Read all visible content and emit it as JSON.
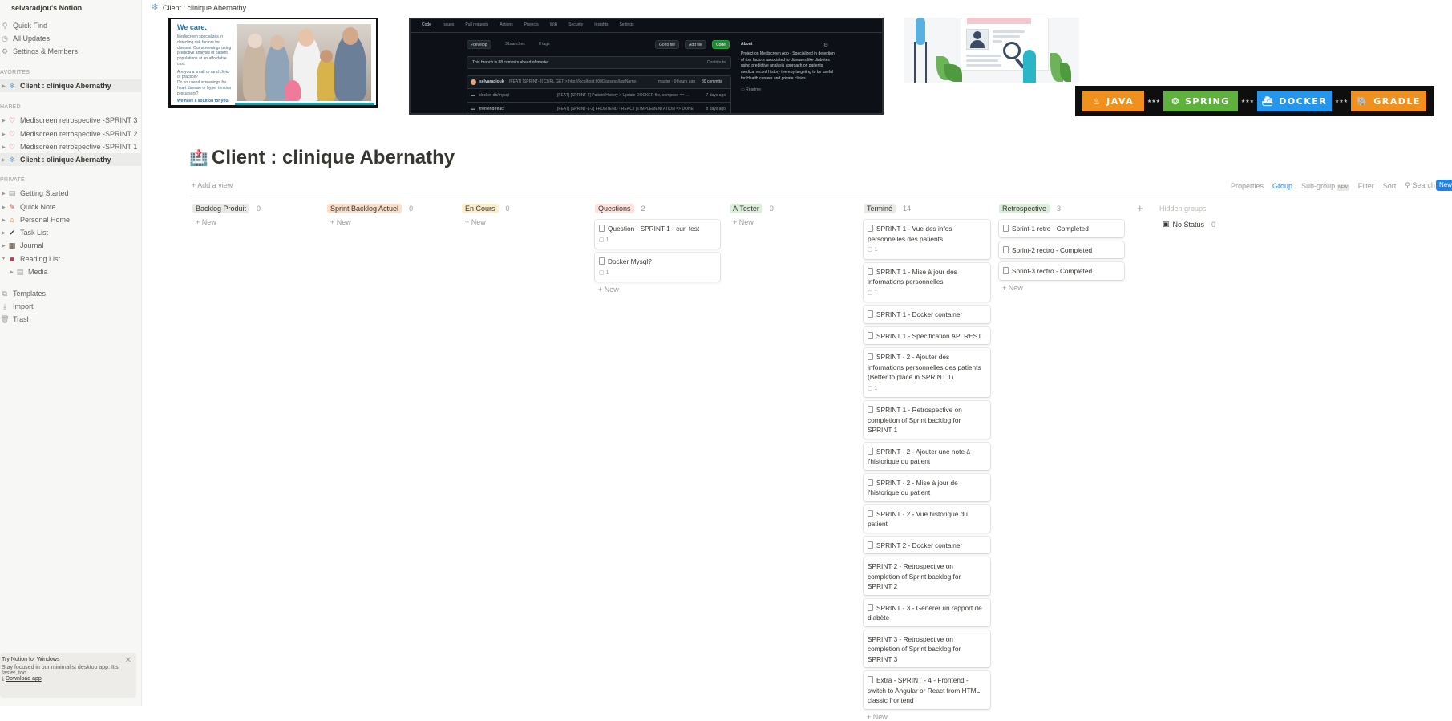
{
  "sidebar": {
    "workspace": "selvaradjou's Notion",
    "top_items": [
      {
        "icon": "search-icon",
        "glyph": "⚲",
        "label": "Quick Find"
      },
      {
        "icon": "clock-icon",
        "glyph": "◷",
        "label": "All Updates"
      },
      {
        "icon": "gear-icon",
        "glyph": "⚙",
        "label": "Settings & Members"
      }
    ],
    "favorites_header": "AVORITES",
    "favorites": [
      {
        "label": "Client : clinique Abernathy"
      }
    ],
    "shared_header": "HARED",
    "shared": [
      {
        "label": "Mediscreen retrospective -SPRINT 3"
      },
      {
        "label": "Mediscreen retrospective -SPRINT 2"
      },
      {
        "label": "Mediscreen retrospective -SPRINT 1"
      },
      {
        "label": "Client : clinique Abernathy"
      }
    ],
    "private_header": "PRIVATE",
    "private": [
      {
        "label": "Getting Started"
      },
      {
        "label": "Quick Note"
      },
      {
        "label": "Personal Home"
      },
      {
        "label": "Task List"
      },
      {
        "label": "Journal"
      },
      {
        "label": "Reading List"
      },
      {
        "label": "Media"
      }
    ],
    "bottom": [
      {
        "label": "Templates"
      },
      {
        "label": "Import"
      },
      {
        "label": "Trash"
      }
    ],
    "promo": {
      "title": "Try Notion for Windows",
      "line1": "Stay focused in our minimalist desktop app. It's",
      "line2": "faster, too.",
      "link": "Download app"
    }
  },
  "topbar": {
    "breadcrumb": "Client : clinique Abernathy"
  },
  "covers": {
    "care": {
      "heading": "We care.",
      "p1": "Mediscreen specializes in detecting risk factors for disease. Our screenings using predictive analysis of patient populations at an affordable cost.",
      "b1": "Are you a small or rural clinic or practice?",
      "b2": "Do you need screenings for heart disease or hyper tension precursors?",
      "solution": "We have a solution for you."
    },
    "github": {
      "tabs": [
        "Code",
        "Issues",
        "Pull requests",
        "Actions",
        "Projects",
        "Wiki",
        "Security",
        "Insights",
        "Settings"
      ],
      "branch": "develop",
      "branches": "3 branches",
      "tags": "0 tags",
      "goto": "Go to file",
      "addfile": "Add file",
      "code": "Code",
      "ahead": "This branch is 88 commits ahead of master.",
      "contribute": "Contribute",
      "commit_user": "selvaradjouk",
      "commit_msg": "[FEAT] [SPRINT-3] CURL GET > http://localhost:8080/assess/lastName...",
      "commit_meta": "master · 9 hours ago",
      "commits": "80 commits",
      "files": [
        {
          "name": "docker-db/mysql",
          "msg": "[FEAT] [SPRINT-2] Patient History > Update DOCKER file, compose == ...",
          "age": "7 days ago"
        },
        {
          "name": "frontend-react",
          "msg": "[FEAT] [SPRINT-1-2] FRONTEND - REACT js IMPLEMENTATION => DONE",
          "age": "8 days ago"
        }
      ],
      "about_title": "About",
      "about": "Project on Mediscreen App - Specialized in detection of risk factors associated to diseases like diabetes using predictive analysis approach on patients medical record history thereby targeting to be useful for Health centers and private clinics.",
      "readme": "Readme"
    },
    "tech": [
      {
        "name": "JAVA",
        "icon": "java-icon",
        "glyph": "♨",
        "color": "#f0901e"
      },
      {
        "name": "SPRING",
        "icon": "spring-icon",
        "glyph": "❂",
        "color": "#5fb13e"
      },
      {
        "name": "DOCKER",
        "icon": "docker-icon",
        "glyph": "⛴",
        "color": "#2496ed"
      },
      {
        "name": "GRADLE",
        "icon": "gradle-icon",
        "glyph": "🐘",
        "color": "#f0901e"
      }
    ],
    "tech_separator": "★★★"
  },
  "page": {
    "title": "Client : clinique Abernathy",
    "icon": "hospital-icon"
  },
  "view": {
    "add_view": "Add a view",
    "tools": {
      "properties": "Properties",
      "group": "Group",
      "subgroup": "Sub-group",
      "new_badge": "NEW",
      "filter": "Filter",
      "sort": "Sort",
      "search": "Search",
      "more": "···",
      "new_button": "New"
    }
  },
  "board": {
    "new_label": "New",
    "columns": [
      {
        "key": "backlog",
        "label": "Backlog Produit",
        "count": "0",
        "bg": "#e9e9e7",
        "cards": []
      },
      {
        "key": "sprint",
        "label": "Sprint Backlog Actuel",
        "count": "0",
        "bg": "#fadec9",
        "cards": []
      },
      {
        "key": "encours",
        "label": "En Cours",
        "count": "0",
        "bg": "#fbeecc",
        "cards": []
      },
      {
        "key": "questions",
        "label": "Questions",
        "count": "2",
        "bg": "#ffe2dd",
        "cards": [
          {
            "title": "Question - SPRINT 1 - curl test",
            "comments": "1",
            "doc": true
          },
          {
            "title": "Docker Mysql?",
            "comments": "1",
            "doc": true
          }
        ]
      },
      {
        "key": "atester",
        "label": "À Tester",
        "count": "0",
        "bg": "#dbeddb",
        "cards": []
      },
      {
        "key": "termine",
        "label": "Terminé",
        "count": "14",
        "bg": "#e9e9e7",
        "cards": [
          {
            "title": "SPRINT 1 - Vue des infos personnelles des patients",
            "comments": "1",
            "doc": true
          },
          {
            "title": "SPRINT 1 - Mise à jour des informations personnelles",
            "comments": "1",
            "doc": true
          },
          {
            "title": "SPRINT 1 - Docker container",
            "doc": true
          },
          {
            "title": "SPRINT 1 - Specification API REST",
            "doc": true
          },
          {
            "title": "SPRINT - 2 - Ajouter des informations personnelles des patients (Better to place in SPRINT 1)",
            "comments": "1",
            "doc": true
          },
          {
            "title": "SPRINT 1 - Retrospective on completion of Sprint backlog for SPRINT 1",
            "doc": true
          },
          {
            "title": "SPRINT - 2 - Ajouter une note à l'historique du patient",
            "doc": true
          },
          {
            "title": "SPRINT - 2 - Mise à jour de l'historique du patient",
            "doc": true
          },
          {
            "title": "SPRINT - 2 - Vue historique du patient",
            "doc": true
          },
          {
            "title": "SPRINT 2 - Docker container",
            "doc": true
          },
          {
            "title": "SPRINT 2 - Retrospective on completion of Sprint backlog for SPRINT 2",
            "doc": false
          },
          {
            "title": "SPRINT - 3 - Générer un rapport de diabète",
            "doc": true
          },
          {
            "title": "SPRINT 3 - Retrospective on completion of Sprint backlog for SPRINT 3",
            "doc": false
          },
          {
            "title": "Extra - SPRINT - 4 - Frontend - switch to Angular or React from HTML classic frontend",
            "doc": true
          }
        ]
      },
      {
        "key": "retro",
        "label": "Retrospective",
        "count": "3",
        "bg": "#dbeddb",
        "cards": [
          {
            "title": "Sprint-1 retro - Completed",
            "doc": true
          },
          {
            "title": "Sprint-2 rectro - Completed",
            "doc": true
          },
          {
            "title": "Sprint-3 rectro - Completed",
            "doc": true
          }
        ]
      }
    ],
    "hidden_groups": "Hidden groups",
    "no_status": {
      "label": "No Status",
      "count": "0"
    }
  }
}
